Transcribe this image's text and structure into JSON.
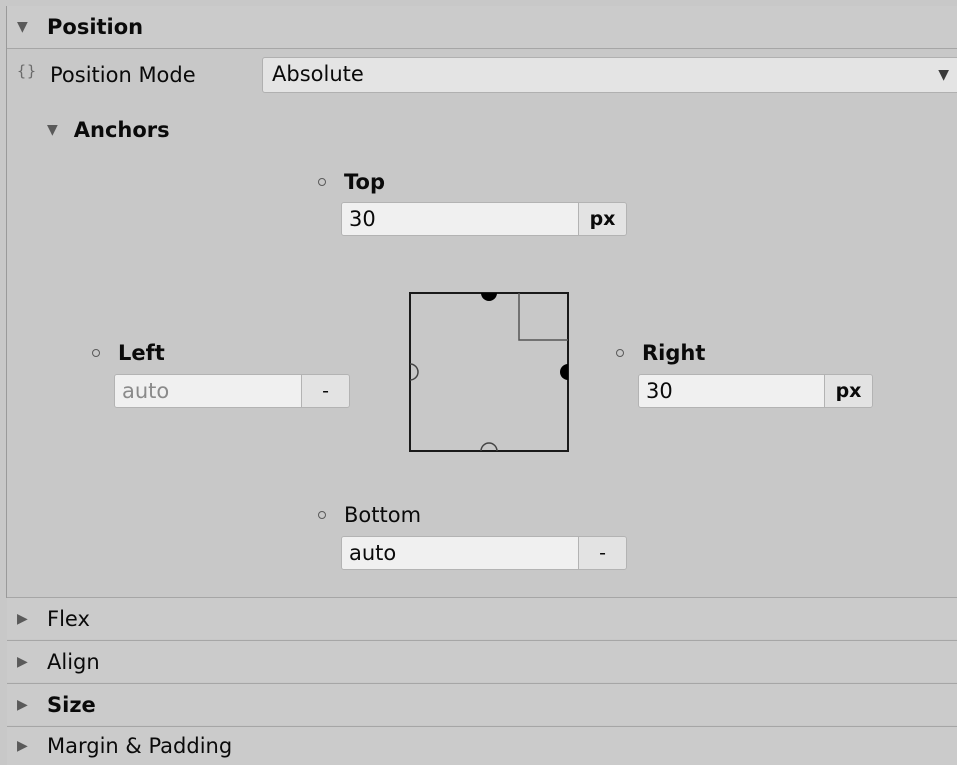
{
  "position": {
    "header_label": "Position",
    "mode_label": "Position Mode",
    "mode_value": "Absolute",
    "anchors": {
      "header_label": "Anchors",
      "top": {
        "label": "Top",
        "value": "30",
        "unit": "px"
      },
      "left": {
        "label": "Left",
        "value": "auto",
        "unit": "-"
      },
      "right": {
        "label": "Right",
        "value": "30",
        "unit": "px"
      },
      "bottom": {
        "label": "Bottom",
        "value": "auto",
        "unit": "-"
      }
    }
  },
  "sections": {
    "flex": "Flex",
    "align": "Align",
    "size": "Size",
    "margin_padding": "Margin & Padding"
  },
  "icons": {
    "expanded": "triangle-down-icon",
    "collapsed": "triangle-right-icon",
    "variable": "braces-icon",
    "dropdown": "caret-down-icon",
    "radio": "radio-circle-icon"
  },
  "colors": {
    "panel_bg": "#c8c8c8",
    "field_bg": "#f0f0f0",
    "unit_bg": "#e3e3e3",
    "dropdown_bg": "#e4e4e4"
  }
}
